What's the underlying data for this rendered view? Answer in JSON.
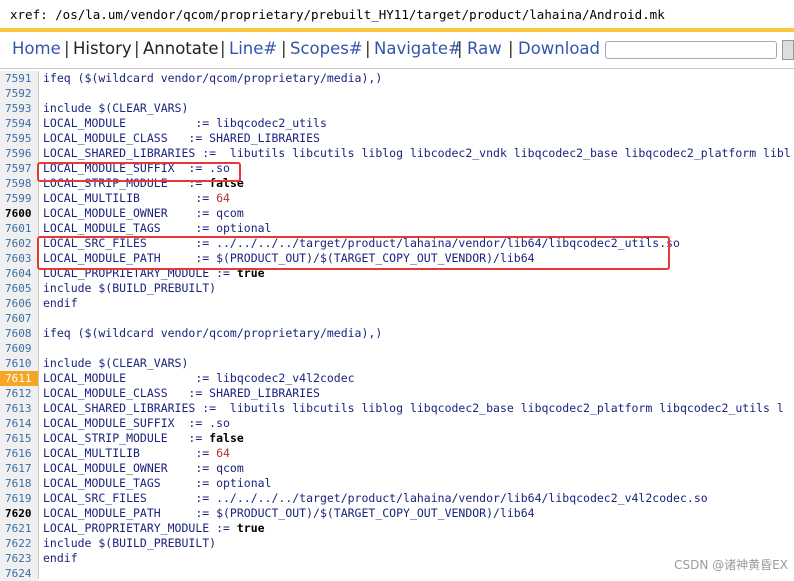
{
  "xref_path": "xref: /os/la.um/vendor/qcom/proprietary/prebuilt_HY11/target/product/lahaina/Android.mk",
  "nav": {
    "home": "Home",
    "history": "History",
    "annotate": "Annotate",
    "line": "Line#",
    "scopes": "Scopes#",
    "navigate": "Navigate#",
    "raw": "Raw",
    "download": "Download",
    "separator": "|"
  },
  "search_value": "",
  "watermark": "CSDN @诸神黄昏EX",
  "lines": [
    {
      "n": "7591",
      "text": "ifeq ($(wildcard vendor/qcom/proprietary/media),)"
    },
    {
      "n": "7592",
      "text": ""
    },
    {
      "n": "7593",
      "text": "include $(CLEAR_VARS)"
    },
    {
      "n": "7594",
      "text": "LOCAL_MODULE          := libqcodec2_utils"
    },
    {
      "n": "7595",
      "text": "LOCAL_MODULE_CLASS   := SHARED_LIBRARIES"
    },
    {
      "n": "7596",
      "text": "LOCAL_SHARED_LIBRARIES :=  libutils libcutils liblog libcodec2_vndk libqcodec2_base libqcodec2_platform libl"
    },
    {
      "n": "7597",
      "text": "LOCAL_MODULE_SUFFIX  := .so"
    },
    {
      "n": "7598",
      "text": "LOCAL_STRIP_MODULE   := ",
      "kw": "false"
    },
    {
      "n": "7599",
      "text": "LOCAL_MULTILIB        := ",
      "num": "64"
    },
    {
      "n": "7600",
      "text": "LOCAL_MODULE_OWNER    := qcom",
      "bold": true
    },
    {
      "n": "7601",
      "text": "LOCAL_MODULE_TAGS     := optional"
    },
    {
      "n": "7602",
      "text": "LOCAL_SRC_FILES       := ../../../../target/product/lahaina/vendor/lib64/libqcodec2_utils.so"
    },
    {
      "n": "7603",
      "text": "LOCAL_MODULE_PATH     := $(PRODUCT_OUT)/$(TARGET_COPY_OUT_VENDOR)/lib64"
    },
    {
      "n": "7604",
      "text": "LOCAL_PROPRIETARY_MODULE := ",
      "kw": "true"
    },
    {
      "n": "7605",
      "text": "include $(BUILD_PREBUILT)"
    },
    {
      "n": "7606",
      "text": "endif"
    },
    {
      "n": "7607",
      "text": ""
    },
    {
      "n": "7608",
      "text": "ifeq ($(wildcard vendor/qcom/proprietary/media),)"
    },
    {
      "n": "7609",
      "text": ""
    },
    {
      "n": "7610",
      "text": "include $(CLEAR_VARS)"
    },
    {
      "n": "7611",
      "text": "LOCAL_MODULE          := libqcodec2_v4l2codec",
      "hl": true
    },
    {
      "n": "7612",
      "text": "LOCAL_MODULE_CLASS   := SHARED_LIBRARIES"
    },
    {
      "n": "7613",
      "text": "LOCAL_SHARED_LIBRARIES :=  libutils libcutils liblog libqcodec2_base libqcodec2_platform libqcodec2_utils l"
    },
    {
      "n": "7614",
      "text": "LOCAL_MODULE_SUFFIX  := .so"
    },
    {
      "n": "7615",
      "text": "LOCAL_STRIP_MODULE   := ",
      "kw": "false"
    },
    {
      "n": "7616",
      "text": "LOCAL_MULTILIB        := ",
      "num": "64"
    },
    {
      "n": "7617",
      "text": "LOCAL_MODULE_OWNER    := qcom"
    },
    {
      "n": "7618",
      "text": "LOCAL_MODULE_TAGS     := optional"
    },
    {
      "n": "7619",
      "text": "LOCAL_SRC_FILES       := ../../../../target/product/lahaina/vendor/lib64/libqcodec2_v4l2codec.so"
    },
    {
      "n": "7620",
      "text": "LOCAL_MODULE_PATH     := $(PRODUCT_OUT)/$(TARGET_COPY_OUT_VENDOR)/lib64",
      "bold": true
    },
    {
      "n": "7621",
      "text": "LOCAL_PROPRIETARY_MODULE := ",
      "kw": "true"
    },
    {
      "n": "7622",
      "text": "include $(BUILD_PREBUILT)"
    },
    {
      "n": "7623",
      "text": "endif"
    },
    {
      "n": "7624",
      "text": ""
    }
  ]
}
